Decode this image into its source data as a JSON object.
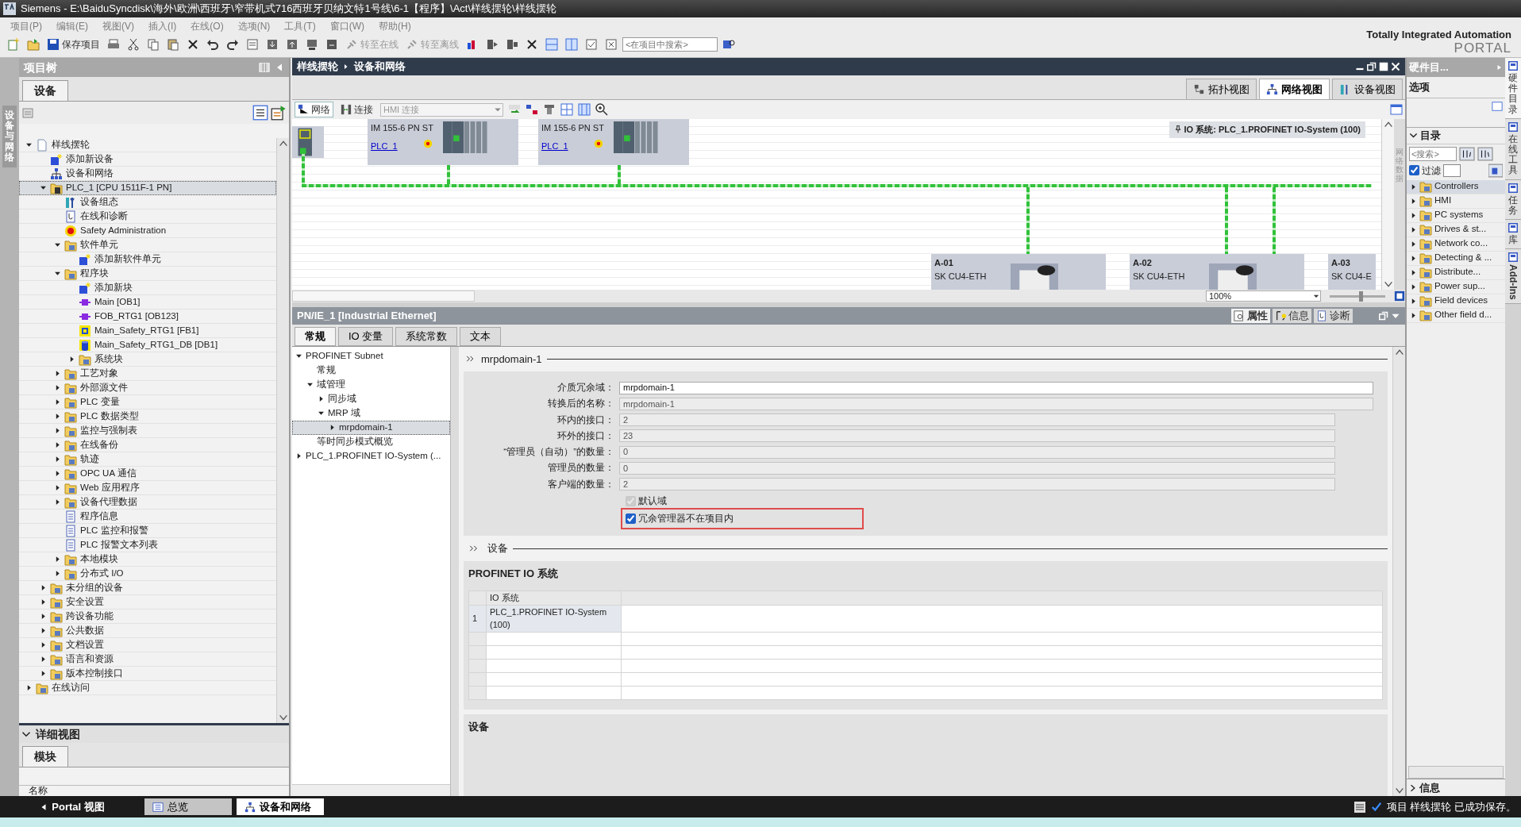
{
  "window": {
    "title": "Siemens  -  E:\\BaiduSyncdisk\\海外\\欧洲\\西班牙\\窄带机式716西班牙贝纳文特1号线\\6-1【程序】\\Act\\样线摆轮\\样线摆轮"
  },
  "menu": [
    "项目(P)",
    "编辑(E)",
    "视图(V)",
    "插入(I)",
    "在线(O)",
    "选项(N)",
    "工具(T)",
    "窗口(W)",
    "帮助(H)"
  ],
  "toolbar": {
    "save_label": "保存项目",
    "go_online": "转至在线",
    "go_offline": "转至离线",
    "search": {
      "placeholder": "<在项目中搜索>"
    }
  },
  "brand": {
    "line_1": "Totally Integrated Automation",
    "line_2": "PORTAL"
  },
  "left_strip": "设备与网络",
  "project_tree": {
    "title": "项目树",
    "tab": "设备",
    "items": [
      {
        "label": "样线摆轮",
        "kind": "project",
        "expanded": true,
        "selected": false,
        "children": [
          {
            "label": "添加新设备",
            "kind": "add",
            "selected": false
          },
          {
            "label": "设备和网络",
            "kind": "network",
            "selected": false
          },
          {
            "label": "PLC_1 [CPU 1511F-1 PN]",
            "kind": "plc",
            "expanded": true,
            "selected": true,
            "children": [
              {
                "label": "设备组态",
                "kind": "config",
                "selected": false
              },
              {
                "label": "在线和诊断",
                "kind": "diag",
                "selected": false
              },
              {
                "label": "Safety Administration",
                "kind": "safety",
                "selected": false
              },
              {
                "label": "软件单元",
                "kind": "folder",
                "expanded": true,
                "selected": false,
                "children": [
                  {
                    "label": "添加新软件单元",
                    "kind": "add",
                    "selected": false
                  }
                ]
              },
              {
                "label": "程序块",
                "kind": "folder",
                "expanded": true,
                "selected": false,
                "children": [
                  {
                    "label": "添加新块",
                    "kind": "add",
                    "selected": false
                  },
                  {
                    "label": "Main [OB1]",
                    "kind": "ob",
                    "selected": false
                  },
                  {
                    "label": "FOB_RTG1 [OB123]",
                    "kind": "ob",
                    "selected": false
                  },
                  {
                    "label": "Main_Safety_RTG1 [FB1]",
                    "kind": "fb",
                    "selected": false
                  },
                  {
                    "label": "Main_Safety_RTG1_DB [DB1]",
                    "kind": "db",
                    "selected": false
                  },
                  {
                    "label": "系统块",
                    "kind": "folder",
                    "expanded": false,
                    "selected": false
                  }
                ]
              },
              {
                "label": "工艺对象",
                "kind": "folder",
                "expanded": false,
                "selected": false
              },
              {
                "label": "外部源文件",
                "kind": "folder",
                "expanded": false,
                "selected": false
              },
              {
                "label": "PLC 变量",
                "kind": "folder",
                "expanded": false,
                "selected": false
              },
              {
                "label": "PLC 数据类型",
                "kind": "folder",
                "expanded": false,
                "selected": false
              },
              {
                "label": "监控与强制表",
                "kind": "folder",
                "expanded": false,
                "selected": false
              },
              {
                "label": "在线备份",
                "kind": "folder",
                "expanded": false,
                "selected": false
              },
              {
                "label": "轨迹",
                "kind": "folder",
                "expanded": false,
                "selected": false
              },
              {
                "label": "OPC UA 通信",
                "kind": "folder",
                "expanded": false,
                "selected": false
              },
              {
                "label": "Web 应用程序",
                "kind": "folder",
                "expanded": false,
                "selected": false
              },
              {
                "label": "设备代理数据",
                "kind": "folder",
                "expanded": false,
                "selected": false
              },
              {
                "label": "程序信息",
                "kind": "doc",
                "selected": false
              },
              {
                "label": "PLC 监控和报警",
                "kind": "doc",
                "selected": false
              },
              {
                "label": "PLC 报警文本列表",
                "kind": "doc",
                "selected": false
              },
              {
                "label": "本地模块",
                "kind": "folder",
                "expanded": false,
                "selected": false
              },
              {
                "label": "分布式 I/O",
                "kind": "folder",
                "expanded": false,
                "selected": false
              }
            ]
          },
          {
            "label": "未分组的设备",
            "kind": "folder",
            "expanded": false,
            "selected": false
          },
          {
            "label": "安全设置",
            "kind": "folder",
            "expanded": false,
            "selected": false
          },
          {
            "label": "跨设备功能",
            "kind": "folder",
            "expanded": false,
            "selected": false
          },
          {
            "label": "公共数据",
            "kind": "folder",
            "expanded": false,
            "selected": false
          },
          {
            "label": "文档设置",
            "kind": "folder",
            "expanded": false,
            "selected": false
          },
          {
            "label": "语言和资源",
            "kind": "folder",
            "expanded": false,
            "selected": false
          },
          {
            "label": "版本控制接口",
            "kind": "folder",
            "expanded": false,
            "selected": false
          }
        ]
      },
      {
        "label": "在线访问",
        "kind": "folder",
        "expanded": false,
        "selected": false
      }
    ]
  },
  "detail_view": {
    "title": "详细视图",
    "tab": "模块",
    "columns": [
      "名称"
    ]
  },
  "editor": {
    "breadcrumb": [
      "样线摆轮",
      "设备和网络"
    ],
    "view_tabs": [
      {
        "label": "拓扑视图",
        "selected": false
      },
      {
        "label": "网络视图",
        "selected": true
      },
      {
        "label": "设备视图",
        "selected": false
      }
    ],
    "toolbar": {
      "network": "网络",
      "connect": "连接",
      "connection_type": "HMI 连接"
    },
    "io_system_label": "IO 系统: PLC_1.PROFINET IO-System (100)",
    "devices": [
      {
        "name": "IM 155-6 PN ST",
        "link": "PLC_1"
      },
      {
        "name": "IM 155-6 PN ST",
        "link": "PLC_1"
      }
    ],
    "drives": [
      {
        "name": "A-01",
        "type": "SK CU4-ETH"
      },
      {
        "name": "A-02",
        "type": "SK CU4-ETH"
      },
      {
        "name": "A-03",
        "type": "SK CU4-E"
      }
    ],
    "zoom": "100%",
    "zoom_slider": {
      "level": 0.55
    },
    "side_label": "网络数据"
  },
  "properties": {
    "title": "PN/IE_1 [Industrial Ethernet]",
    "panel_tabs": [
      {
        "label": "属性",
        "selected": true
      },
      {
        "label": "信息",
        "selected": false
      },
      {
        "label": "诊断",
        "selected": false
      }
    ],
    "tabs": [
      {
        "label": "常规",
        "selected": true
      },
      {
        "label": "IO 变量",
        "selected": false
      },
      {
        "label": "系统常数",
        "selected": false
      },
      {
        "label": "文本",
        "selected": false
      }
    ],
    "nav": [
      {
        "label": "PROFINET Subnet",
        "expanded": true,
        "selected": false,
        "children": [
          {
            "label": "常规",
            "selected": false
          },
          {
            "label": "域管理",
            "expanded": true,
            "selected": false,
            "children": [
              {
                "label": "同步域",
                "expanded": false,
                "selected": false
              },
              {
                "label": "MRP 域",
                "expanded": true,
                "selected": false,
                "children": [
                  {
                    "label": "mrpdomain-1",
                    "expanded": false,
                    "selected": true
                  }
                ]
              }
            ]
          },
          {
            "label": "等时同步模式概览",
            "selected": false
          }
        ]
      },
      {
        "label": "PLC_1.PROFINET IO-System (...",
        "expanded": false,
        "selected": false
      }
    ],
    "section_title": "mrpdomain-1",
    "fields": [
      {
        "label": "介质冗余域：",
        "value": "mrpdomain-1",
        "kind": "name",
        "editable": true
      },
      {
        "label": "转换后的名称：",
        "value": "mrpdomain-1",
        "kind": "name",
        "editable": false
      },
      {
        "label": "环内的接口：",
        "value": "2",
        "kind": "number",
        "editable": false
      },
      {
        "label": "环外的接口：",
        "value": "23",
        "kind": "number",
        "editable": false
      },
      {
        "label": "“管理员（自动）”的数量：",
        "value": "0",
        "kind": "number",
        "editable": false
      },
      {
        "label": "管理员的数量：",
        "value": "0",
        "kind": "number",
        "editable": false
      },
      {
        "label": "客户端的数量：",
        "value": "2",
        "kind": "number",
        "editable": false
      }
    ],
    "checkboxes": [
      {
        "label": "默认域",
        "checked": true,
        "disabled": true,
        "highlighted": false
      },
      {
        "label": "冗余管理器不在项目内",
        "checked": true,
        "disabled": false,
        "highlighted": true
      }
    ],
    "devices_section": "设备",
    "io_system_box": {
      "title": "PROFINET IO 系统",
      "columns": [
        "IO 系统"
      ],
      "rows": [
        {
          "index": "1",
          "cells": [
            "PLC_1.PROFINET IO-System (100)"
          ]
        }
      ]
    },
    "devices_box_title": "设备"
  },
  "catalog": {
    "title": "硬件目...",
    "options": "选项",
    "heading": "目录",
    "search": {
      "placeholder": "<搜索>"
    },
    "filter": {
      "label": "过滤",
      "checked": true
    },
    "items": [
      {
        "label": "Controllers",
        "selected": true
      },
      {
        "label": "HMI",
        "selected": false
      },
      {
        "label": "PC systems",
        "selected": false
      },
      {
        "label": "Drives & st...",
        "selected": false
      },
      {
        "label": "Network co...",
        "selected": false
      },
      {
        "label": "Detecting & ...",
        "selected": false
      },
      {
        "label": "Distribute...",
        "selected": false
      },
      {
        "label": "Power sup...",
        "selected": false
      },
      {
        "label": "Field devices",
        "selected": false
      },
      {
        "label": "Other field d...",
        "selected": false
      }
    ],
    "info": "信息"
  },
  "right_tabs": [
    {
      "label": "硬件目录",
      "kind": "cjk",
      "selected": true
    },
    {
      "label": "在线工具",
      "kind": "cjk",
      "selected": false
    },
    {
      "label": "任务",
      "kind": "cjk",
      "selected": false
    },
    {
      "label": "库",
      "kind": "cjk",
      "selected": false
    },
    {
      "label": "Add-Ins",
      "kind": "latin",
      "selected": false
    }
  ],
  "taskbar": {
    "portal": "Portal 视图",
    "tabs": [
      {
        "label": "总览",
        "selected": false
      },
      {
        "label": "设备和网络",
        "selected": true
      }
    ],
    "status": "项目 样线摆轮 已成功保存。"
  }
}
